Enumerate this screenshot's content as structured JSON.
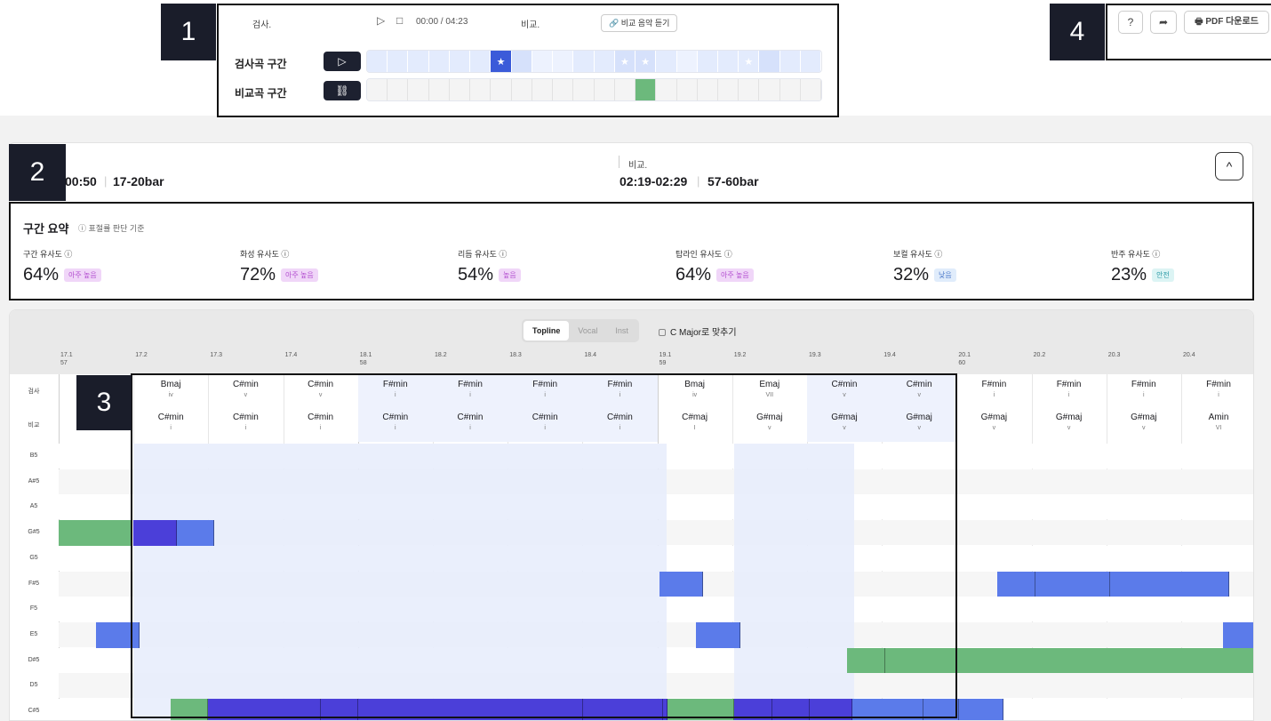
{
  "player": {
    "label1": "검사.",
    "time": "00:00 / 04:23",
    "label2": "비교.",
    "compare_button": "비교 음악 듣기",
    "seg1_label": "검사곡 구간",
    "seg2_label": "비교곡 구간"
  },
  "markers": [
    "1",
    "2",
    "3",
    "4"
  ],
  "toolbar": {
    "help_icon": "question-icon",
    "share_icon": "share-icon",
    "pdf_label": "PDF 다운로드"
  },
  "info": {
    "left_time": "00:50",
    "left_bar": "17-20bar",
    "right_label": "비교.",
    "right_time": "02:19-02:29",
    "right_bar": "57-60bar"
  },
  "summary": {
    "title": "구간 요약",
    "note": "표절률 판단 기준",
    "metrics": [
      {
        "label": "구간 유사도",
        "value": "64%",
        "badge": "아주 높음",
        "tone": "purple"
      },
      {
        "label": "화성 유사도",
        "value": "72%",
        "badge": "아주 높음",
        "tone": "purple"
      },
      {
        "label": "리듬 유사도",
        "value": "54%",
        "badge": "높음",
        "tone": "purple"
      },
      {
        "label": "탑라인 유사도",
        "value": "64%",
        "badge": "아주 높음",
        "tone": "purple"
      },
      {
        "label": "보컬 유사도",
        "value": "32%",
        "badge": "낮음",
        "tone": "blue"
      },
      {
        "label": "반주 유사도",
        "value": "23%",
        "badge": "안전",
        "tone": "cyan"
      }
    ]
  },
  "grid": {
    "tabs": [
      "Topline",
      "Vocal",
      "Inst"
    ],
    "active_tab": "Topline",
    "c_major": "C Major로 맞추기",
    "beats": [
      {
        "b": "17.1",
        "bar": "57"
      },
      {
        "b": "17.2",
        "bar": ""
      },
      {
        "b": "17.3",
        "bar": ""
      },
      {
        "b": "17.4",
        "bar": ""
      },
      {
        "b": "18.1",
        "bar": "58"
      },
      {
        "b": "18.2",
        "bar": ""
      },
      {
        "b": "18.3",
        "bar": ""
      },
      {
        "b": "18.4",
        "bar": ""
      },
      {
        "b": "19.1",
        "bar": "59"
      },
      {
        "b": "19.2",
        "bar": ""
      },
      {
        "b": "19.3",
        "bar": ""
      },
      {
        "b": "19.4",
        "bar": ""
      },
      {
        "b": "20.1",
        "bar": "60"
      },
      {
        "b": "20.2",
        "bar": ""
      },
      {
        "b": "20.3",
        "bar": ""
      },
      {
        "b": "20.4",
        "bar": ""
      }
    ],
    "row_labels": {
      "test": "검사",
      "compare": "비교"
    },
    "test_chords": [
      {
        "c": "Bmaj",
        "r": "iv"
      },
      {
        "c": "C#min",
        "r": "v"
      },
      {
        "c": "C#min",
        "r": "v"
      },
      {
        "c": "F#min",
        "r": "i"
      },
      {
        "c": "F#min",
        "r": "i"
      },
      {
        "c": "F#min",
        "r": "i"
      },
      {
        "c": "F#min",
        "r": "i"
      },
      {
        "c": "Bmaj",
        "r": "iv"
      },
      {
        "c": "Emaj",
        "r": "VII"
      },
      {
        "c": "C#min",
        "r": "v"
      },
      {
        "c": "C#min",
        "r": "v"
      },
      {
        "c": "F#min",
        "r": "i"
      },
      {
        "c": "F#min",
        "r": "i"
      },
      {
        "c": "F#min",
        "r": "i"
      },
      {
        "c": "F#min",
        "r": "i"
      }
    ],
    "compare_chords": [
      {
        "c": "C#min",
        "r": "i"
      },
      {
        "c": "C#min",
        "r": "i"
      },
      {
        "c": "C#min",
        "r": "i"
      },
      {
        "c": "C#min",
        "r": "i"
      },
      {
        "c": "C#min",
        "r": "i"
      },
      {
        "c": "C#min",
        "r": "i"
      },
      {
        "c": "C#min",
        "r": "i"
      },
      {
        "c": "C#maj",
        "r": "I"
      },
      {
        "c": "G#maj",
        "r": "v"
      },
      {
        "c": "G#maj",
        "r": "v"
      },
      {
        "c": "G#maj",
        "r": "v"
      },
      {
        "c": "G#maj",
        "r": "v"
      },
      {
        "c": "G#maj",
        "r": "v"
      },
      {
        "c": "G#maj",
        "r": "v"
      },
      {
        "c": "Amin",
        "r": "VI"
      }
    ],
    "pitches": [
      "B5",
      "A#5",
      "A5",
      "G#5",
      "G5",
      "F#5",
      "F5",
      "E5",
      "D#5",
      "D5",
      "C#5"
    ]
  },
  "colors": {
    "green": "#6cb97c",
    "blue": "#5b7bea",
    "indigo": "#4b3fd9",
    "light": "#e6ecfc",
    "dark": "#1d2130"
  }
}
